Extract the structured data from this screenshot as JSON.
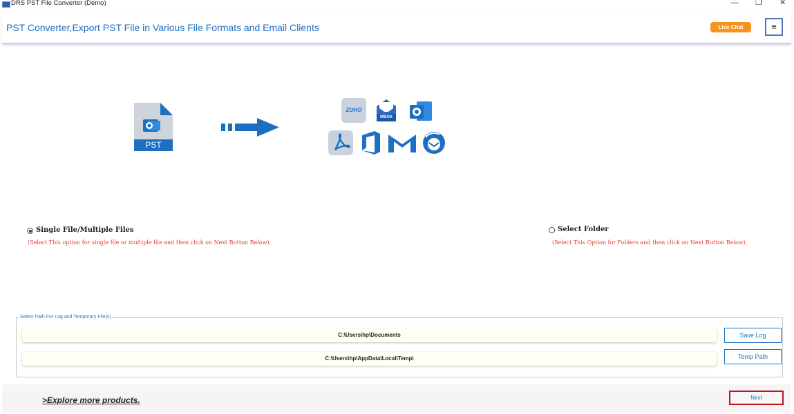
{
  "window": {
    "title": "DRS PST File Converter (Demo)",
    "minimize_glyph": "—",
    "restore_glyph": "❐",
    "close_glyph": "✕"
  },
  "header": {
    "title": "PST Converter,Export PST File in Various File Formats and Email Clients",
    "live_chat_label": "Live Chat",
    "menu_glyph": "≡"
  },
  "illustration": {
    "source_label": "PST",
    "target_icons": [
      "zoho-icon",
      "mbox-icon",
      "outlook-icon",
      "pdf-icon",
      "office365-icon",
      "gmail-icon",
      "thunderbird-icon"
    ],
    "mbox_label": "MBOX",
    "zoho_label": "ZOHO"
  },
  "options": {
    "single": {
      "label": "Single File/Multiple Files",
      "hint": "(Select This option for single file or multiple file and then click on Next Button Below).",
      "selected": true
    },
    "folder": {
      "label": "Select Folder",
      "hint": "(Select This Option for Folders and then click on Next Button Below).",
      "selected": false
    }
  },
  "paths": {
    "legend": "Select Path For Log and Temporary File(s)",
    "log_path": "C:\\Users\\hp\\Documents",
    "temp_path": "C:\\Users\\hp\\AppData\\Local\\Temp\\",
    "save_log_label": "Save Log",
    "temp_path_label": "Temp Path"
  },
  "footer": {
    "explore_label": ">Explore more products.",
    "next_label": "Next"
  },
  "colors": {
    "accent_blue": "#1e6fc2",
    "live_chat": "#f7941d",
    "hint_red": "#e53a2f",
    "next_border": "#c0121f"
  }
}
